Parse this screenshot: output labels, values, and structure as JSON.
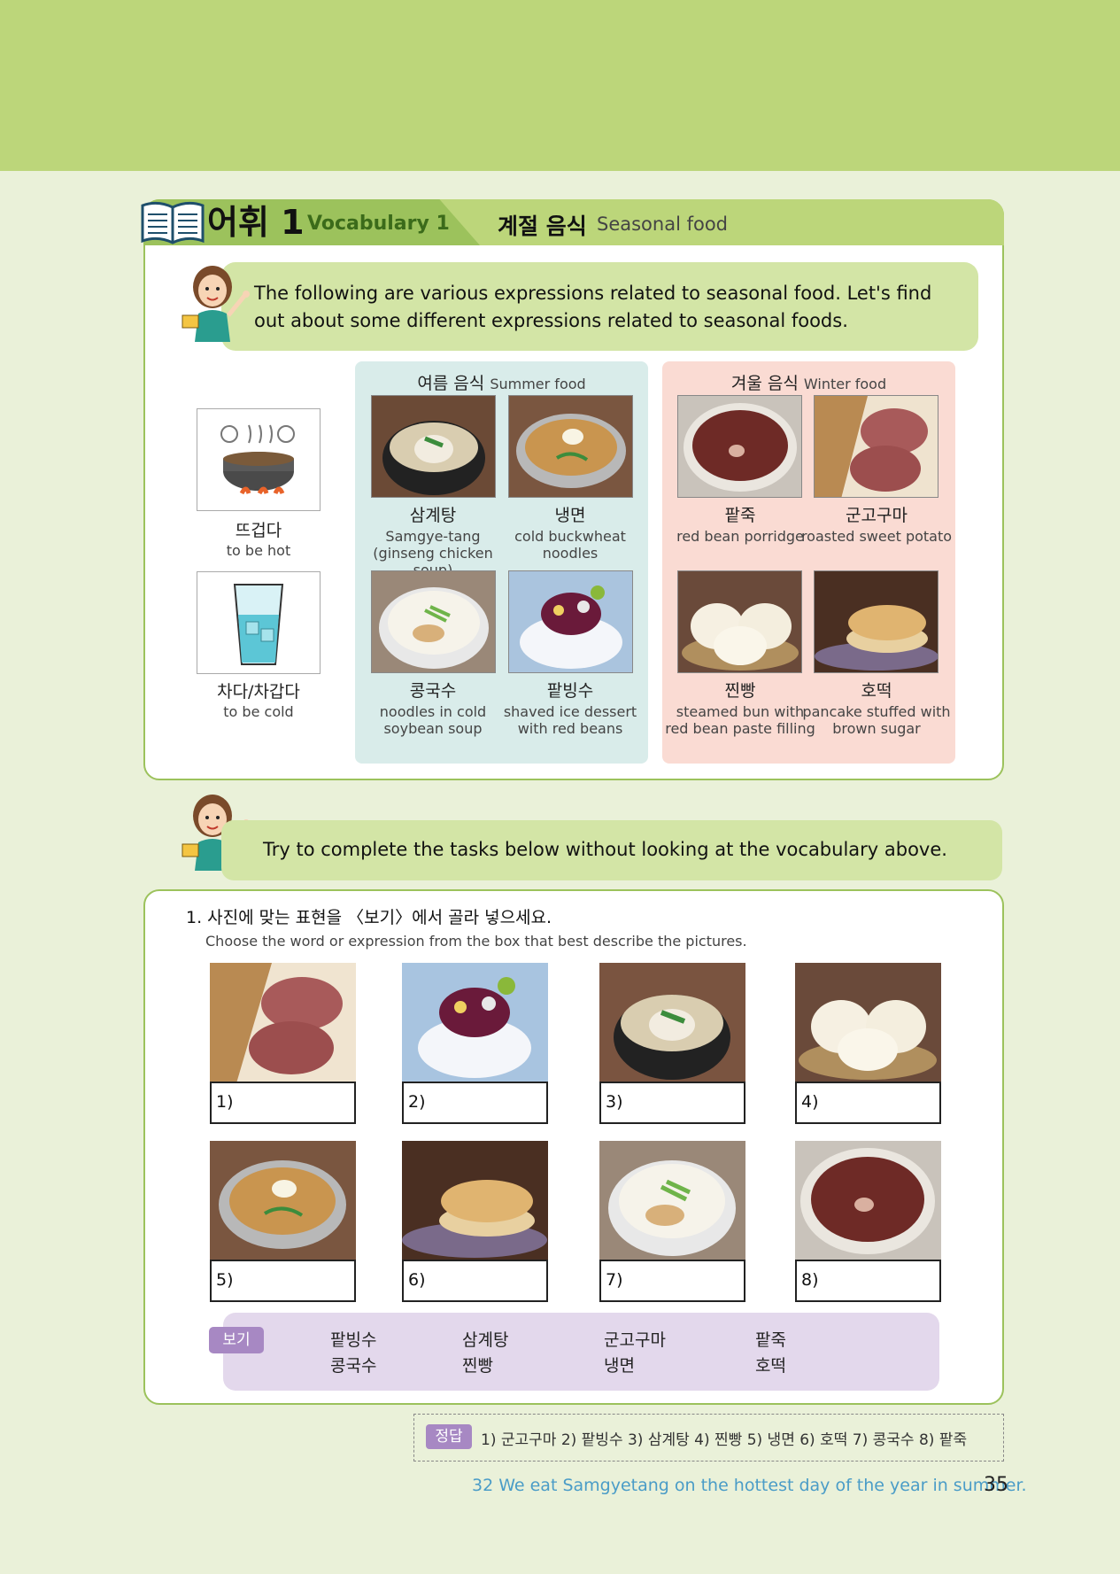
{
  "vocab": {
    "title_ko": "어휘 1",
    "title_en": "Vocabulary 1",
    "topic_ko": "계절 음식",
    "topic_en": "Seasonal food",
    "intro": "The following are various expressions related to seasonal food. Let's find out about some different expressions related to seasonal foods."
  },
  "adjectives": [
    {
      "ko": "뜨겁다",
      "en": "to be hot",
      "icon": "hot-pot-icon"
    },
    {
      "ko": "차다/차갑다",
      "en": "to be cold",
      "icon": "cold-drink-icon"
    }
  ],
  "summer": {
    "title_ko": "여름 음식",
    "title_en": "Summer food",
    "items": [
      {
        "ko": "삼계탕",
        "en": "Samgye-tang (ginseng chicken soup)"
      },
      {
        "ko": "냉면",
        "en": "cold buckwheat noodles"
      },
      {
        "ko": "콩국수",
        "en": "noodles in cold soybean soup"
      },
      {
        "ko": "팥빙수",
        "en": "shaved ice dessert with red beans"
      }
    ]
  },
  "winter": {
    "title_ko": "겨울 음식",
    "title_en": "Winter food",
    "items": [
      {
        "ko": "팥죽",
        "en": "red bean porridge"
      },
      {
        "ko": "군고구마",
        "en": "roasted sweet potato"
      },
      {
        "ko": "찐빵",
        "en": "steamed bun with red bean paste filling"
      },
      {
        "ko": "호떡",
        "en": "pancake stuffed with brown sugar"
      }
    ]
  },
  "task": {
    "instruction": "Try to complete the tasks below without looking at the vocabulary above.",
    "question_ko": "1. 사진에 맞는 표현을 〈보기〉에서 골라 넣으세요.",
    "question_en": "Choose the word or expression from the box that best describe the pictures.",
    "boxes": [
      "1)",
      "2)",
      "3)",
      "4)",
      "5)",
      "6)",
      "7)",
      "8)"
    ],
    "box_label": "보기",
    "box_words": [
      "팥빙수",
      "콩국수",
      "삼계탕",
      "찐빵",
      "군고구마",
      "냉면",
      "팥죽",
      "호떡"
    ],
    "answer_label": "정답",
    "answer": "1) 군고구마  2) 팥빙수  3) 삼계탕  4) 찐빵  5) 냉면  6) 호떡  7) 콩국수  8) 팥죽"
  },
  "footer": {
    "subtitle": "32 We eat Samgyetang on the hottest day of the year in summer.",
    "page": "35"
  }
}
